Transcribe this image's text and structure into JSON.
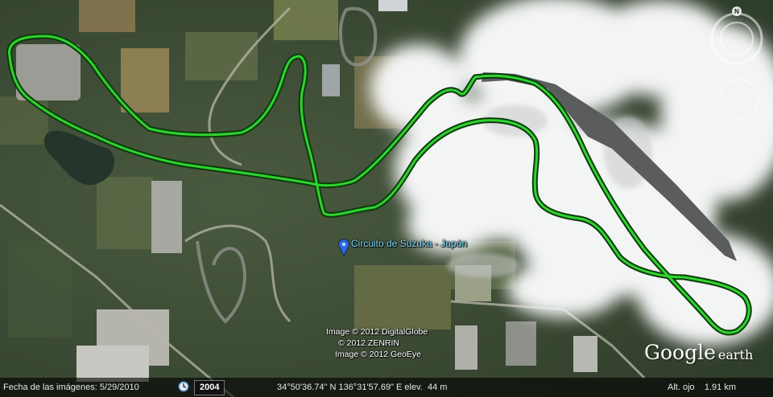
{
  "placemark": {
    "label": "Circuito de Suzuka - Japón"
  },
  "imagery_credits": [
    "Image © 2012 DigitalGlobe",
    "© 2012 ZENRIN",
    "Image © 2012 GeoEye"
  ],
  "logo": {
    "google": "Google",
    "earth": "earth"
  },
  "nav": {
    "north_label": "N"
  },
  "status_bar": {
    "imagery_date": "Fecha de las imágenes: 5/29/2010",
    "historical_year": "2004",
    "coordinates": "34°50'36.74\" N 136°31'57.69\" E elev.",
    "elevation": "44 m",
    "eye_alt": "Alt. ojo    1.91 km"
  },
  "colors": {
    "track_overlay": "#2fd22f",
    "label_text": "#7fe0ff",
    "status_bg": "#000000"
  }
}
